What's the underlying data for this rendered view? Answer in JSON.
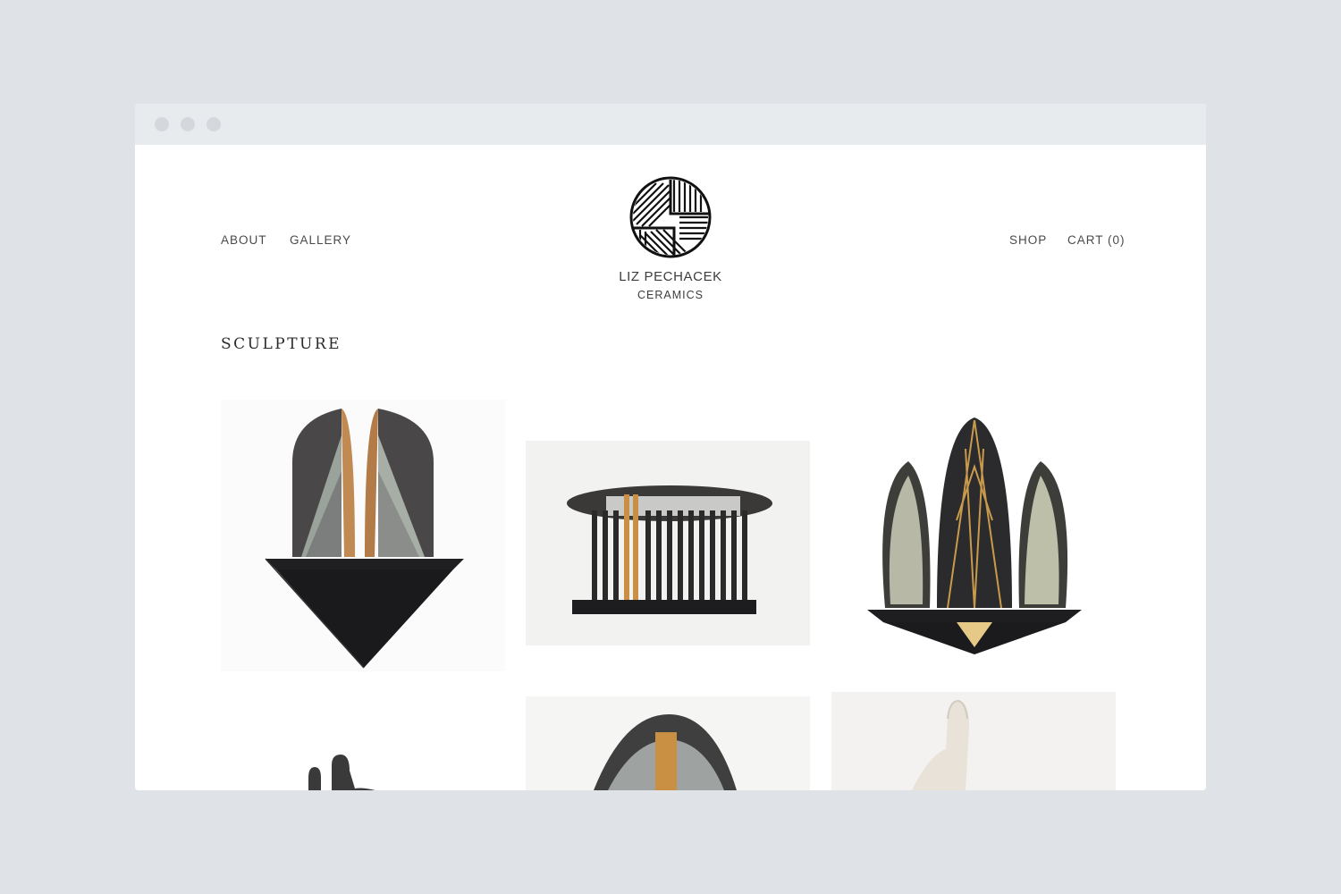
{
  "nav": {
    "about": "ABOUT",
    "gallery": "GALLERY",
    "shop": "SHOP",
    "cart": "CART (0)"
  },
  "brand": {
    "name": "LIZ PECHACEK",
    "subtitle": "CERAMICS"
  },
  "page": {
    "title": "SCULPTURE"
  },
  "colors": {
    "page_background": "#dfe2e7",
    "chrome_bar": "#e8ebee",
    "text": "#3d3d3d",
    "gold_accent": "#c9954a"
  }
}
